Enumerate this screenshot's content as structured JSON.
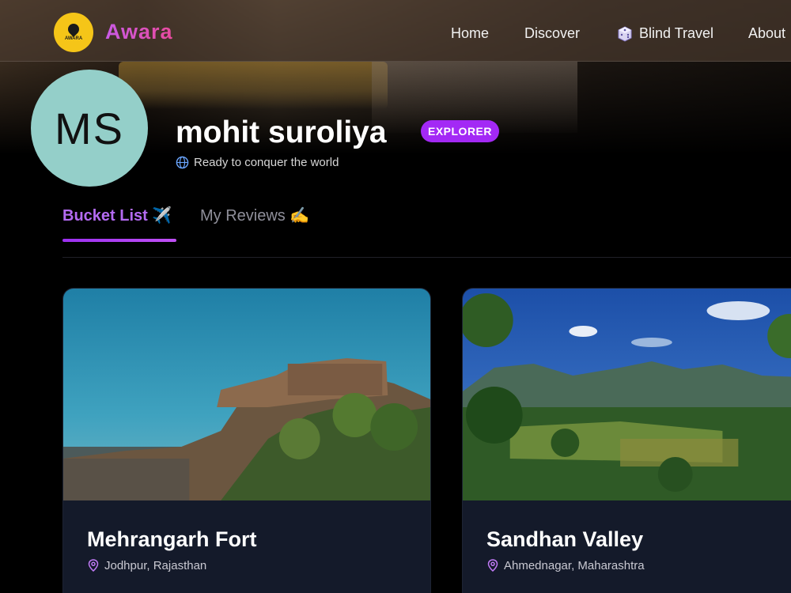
{
  "brand": {
    "name": "Awara",
    "logo_small_text": "AWARA"
  },
  "nav": {
    "home": "Home",
    "discover": "Discover",
    "blind_travel": "Blind Travel",
    "about": "About"
  },
  "profile": {
    "initials": "MS",
    "name": "mohit suroliya",
    "badge": "EXPLORER",
    "status": "Ready to conquer the world"
  },
  "tabs": [
    {
      "label": "Bucket List ✈️",
      "active": true
    },
    {
      "label": "My Reviews ✍️",
      "active": false
    }
  ],
  "places": [
    {
      "title": "Mehrangarh Fort",
      "location": "Jodhpur, Rajasthan"
    },
    {
      "title": "Sandhan Valley",
      "location": "Ahmednagar, Maharashtra"
    }
  ],
  "colors": {
    "accent": "#a329f5",
    "brand_gradient_start": "#c95be6",
    "brand_gradient_end": "#e94a9d",
    "avatar_bg": "#94cfc9",
    "logo_bg": "#f5c518",
    "card_bg": "#141a2a"
  },
  "icons": {
    "blind_travel": "dice-icon",
    "status": "globe-icon",
    "location": "map-pin-icon"
  }
}
